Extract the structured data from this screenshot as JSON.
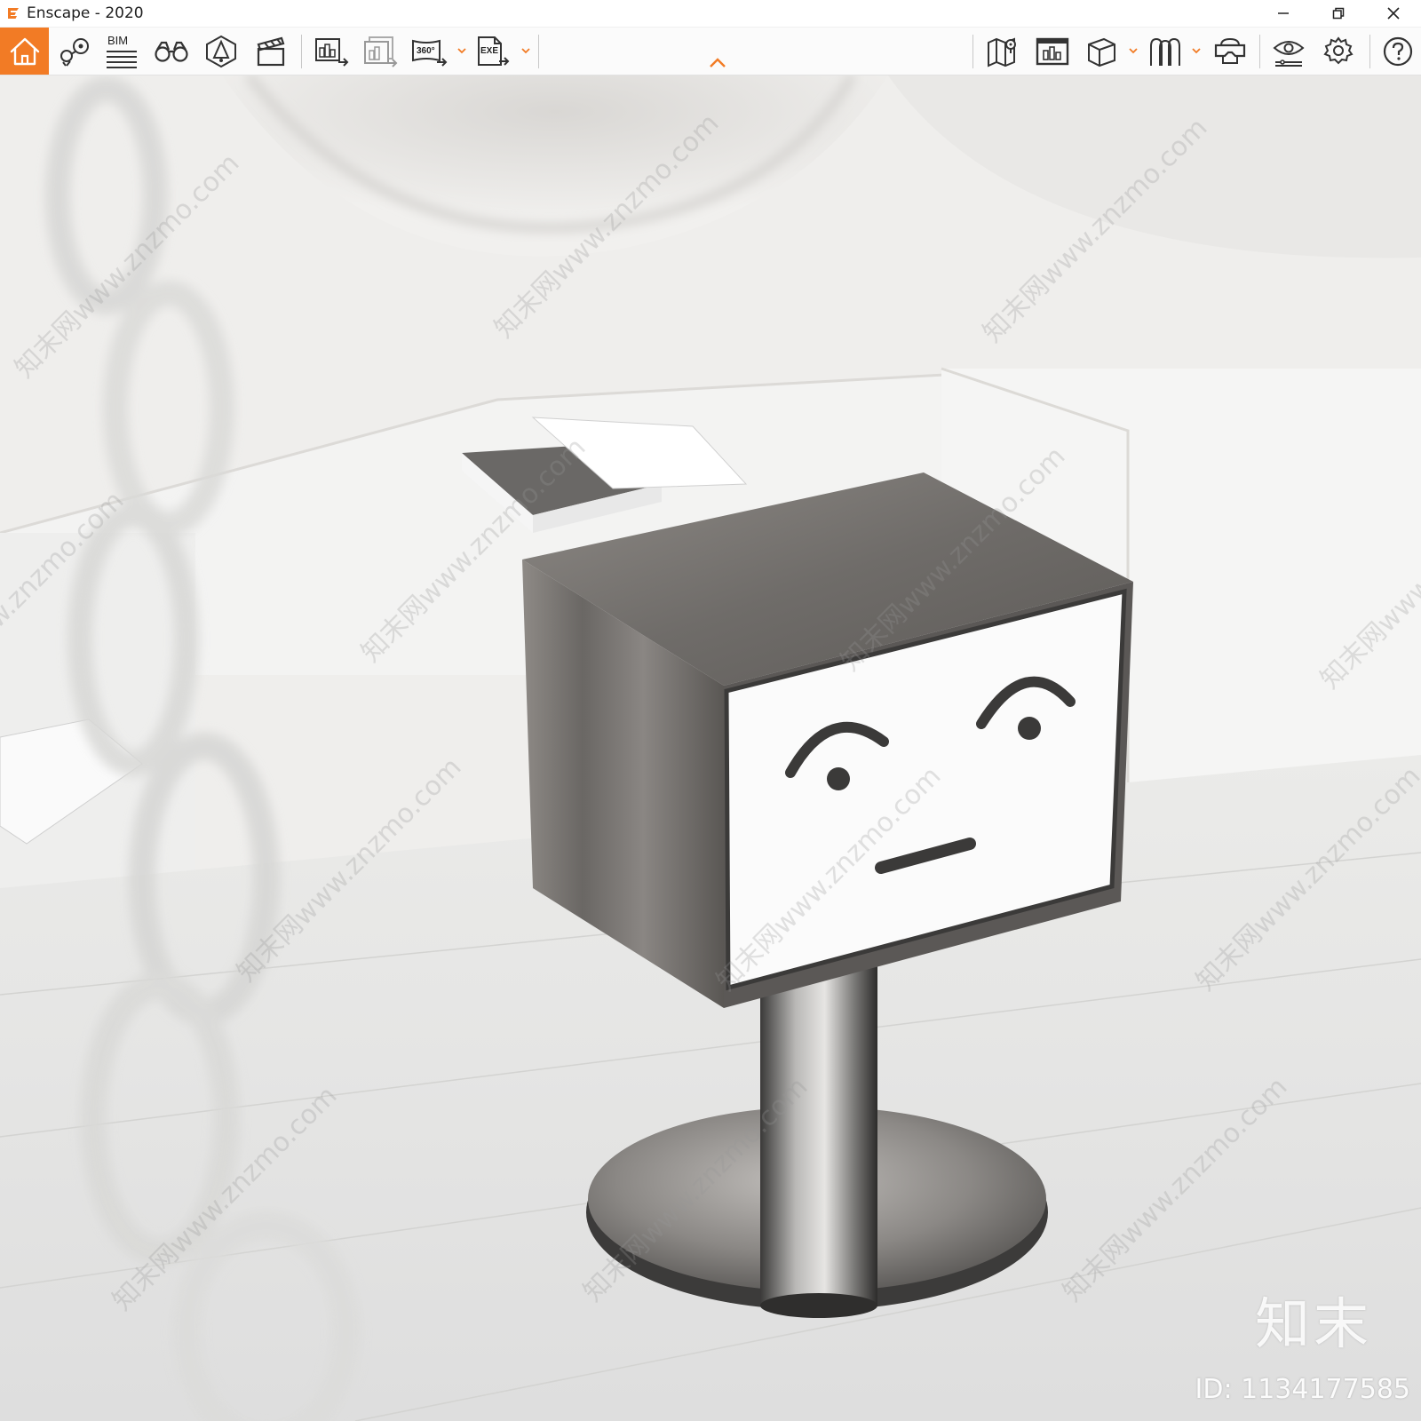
{
  "window": {
    "title": "Enscape - 2020",
    "accent_color": "#f27b25"
  },
  "window_controls": {
    "minimize_icon": "minimize-icon",
    "restore_icon": "restore-icon",
    "close_icon": "close-icon"
  },
  "toolbar": {
    "bim_label": "BIM",
    "panorama_label": "360°",
    "exe_label": "EXE",
    "left_tools": [
      "home-icon",
      "views-icon",
      "bim-info-icon",
      "binoculars-icon",
      "visual-settings-icon",
      "clapper-icon",
      "batch-render-icon",
      "render-image-icon",
      "panorama-export-icon",
      "exe-export-icon"
    ],
    "right_tools": [
      "map-icon",
      "gallery-icon",
      "cube-icon",
      "asset-library-icon",
      "vr-headset-icon",
      "view-options-icon",
      "settings-icon",
      "help-icon"
    ]
  },
  "viewport": {
    "watermark": "知末网www.znzmo.com",
    "brand": "知末",
    "brand_id": "ID: 1134177585"
  }
}
